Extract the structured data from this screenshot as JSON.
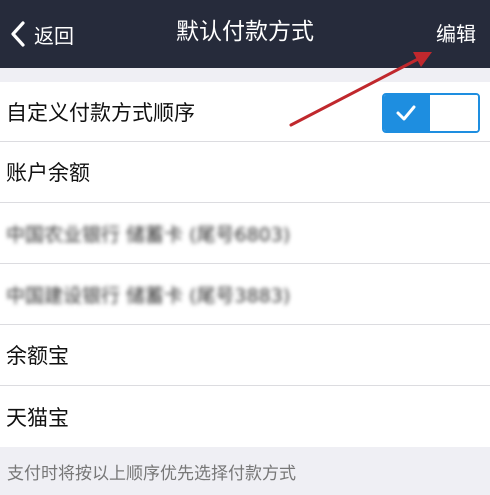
{
  "navbar": {
    "back_label": "返回",
    "title": "默认付款方式",
    "edit_label": "编辑"
  },
  "custom_order": {
    "label": "自定义付款方式顺序",
    "enabled": true
  },
  "payment_methods": [
    {
      "label": "账户余额",
      "blurred": false
    },
    {
      "label": "中国农业银行 储蓄卡 (尾号6803)",
      "blurred": true
    },
    {
      "label": "中国建设银行 储蓄卡 (尾号3883)",
      "blurred": true
    },
    {
      "label": "余额宝",
      "blurred": false
    },
    {
      "label": "天猫宝",
      "blurred": false
    }
  ],
  "footer_note": "支付时将按以上顺序优先选择付款方式",
  "colors": {
    "navbar_bg": "#262b3b",
    "toggle_accent": "#1e8ee0",
    "annotation_arrow": "#c0282d"
  }
}
